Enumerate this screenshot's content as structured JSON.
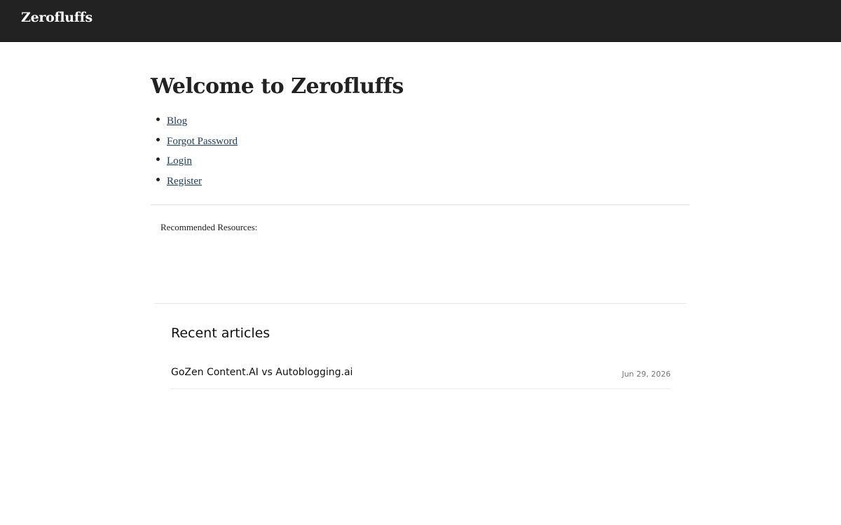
{
  "header": {
    "brand": "Zerofluffs"
  },
  "main": {
    "title": "Welcome to Zerofluffs",
    "nav_links": [
      {
        "label": "Blog"
      },
      {
        "label": "Forgot Password"
      },
      {
        "label": "Login"
      },
      {
        "label": "Register"
      }
    ],
    "resources_label": "Recommended Resources:"
  },
  "recent": {
    "title": "Recent articles",
    "articles": [
      {
        "title": "GoZen Content.AI vs Autoblogging.ai",
        "date": "Jun 29, 2026"
      }
    ]
  },
  "colors": {
    "header_bg": "#222222",
    "link": "#1a3a5e"
  }
}
